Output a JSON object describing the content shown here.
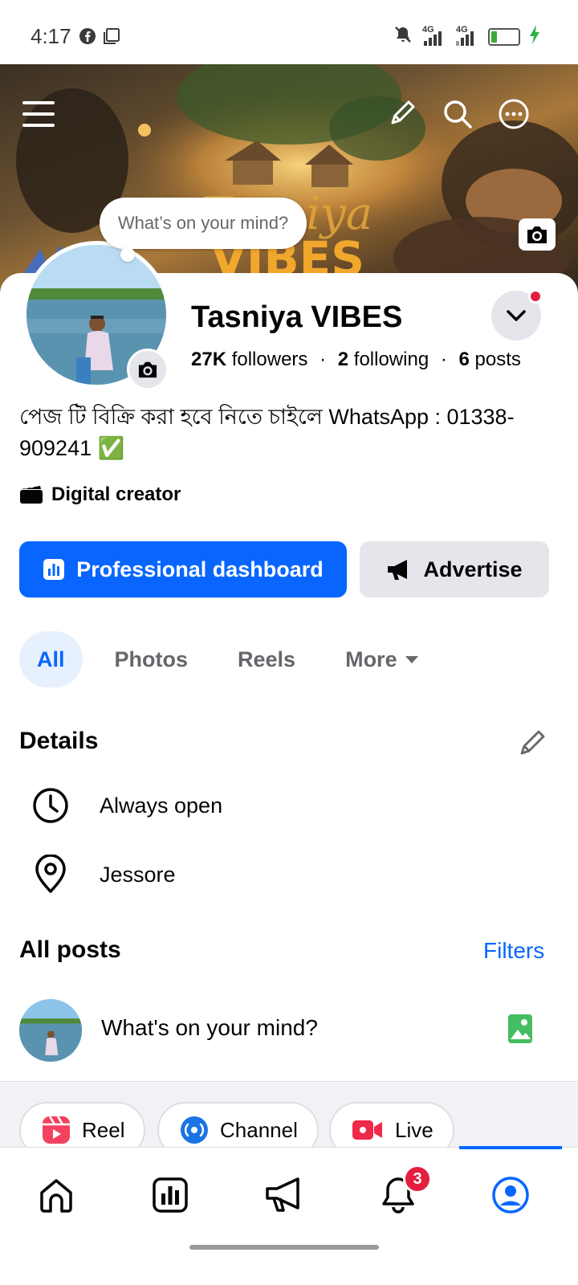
{
  "status_bar": {
    "time": "4:17",
    "network_1": "4G",
    "network_2": "4G",
    "battery": "4",
    "battery_fraction": 0.2
  },
  "cover": {
    "title_text": "Tasniya VIBES",
    "actions": [
      "menu-icon",
      "pencil-icon",
      "search-icon",
      "more-icon"
    ]
  },
  "composer_bubble": {
    "text": "What’s on your mind?"
  },
  "profile": {
    "name": "Tasniya VIBES",
    "followers_count": "27K",
    "followers_label": "followers",
    "following_count": "2",
    "following_label": "following",
    "posts_count": "6",
    "posts_label": "posts",
    "separator": "·",
    "bio": "পেজ টি বিক্রি করা হবে নিতে চাইলে WhatsApp : 01338-909241 ✅",
    "category": "Digital creator"
  },
  "actions": {
    "professional_dashboard": "Professional dashboard",
    "advertise": "Advertise"
  },
  "tabs": {
    "all": "All",
    "photos": "Photos",
    "reels": "Reels",
    "more": "More"
  },
  "details": {
    "title": "Details",
    "hours": "Always open",
    "location": "Jessore"
  },
  "posts": {
    "title": "All posts",
    "filters": "Filters",
    "composer_placeholder": "What's on your mind?"
  },
  "create_chips": {
    "reel": "Reel",
    "channel": "Channel",
    "live": "Live"
  },
  "bottom_nav": {
    "notifications_badge": "3",
    "items": [
      "home-icon",
      "dashboard-icon",
      "megaphone-icon",
      "bell-icon",
      "profile-icon"
    ]
  },
  "colors": {
    "accent": "#0866ff",
    "badge": "#e41e3f",
    "secondary_button": "#e4e6eb",
    "muted_text": "#65676b"
  }
}
